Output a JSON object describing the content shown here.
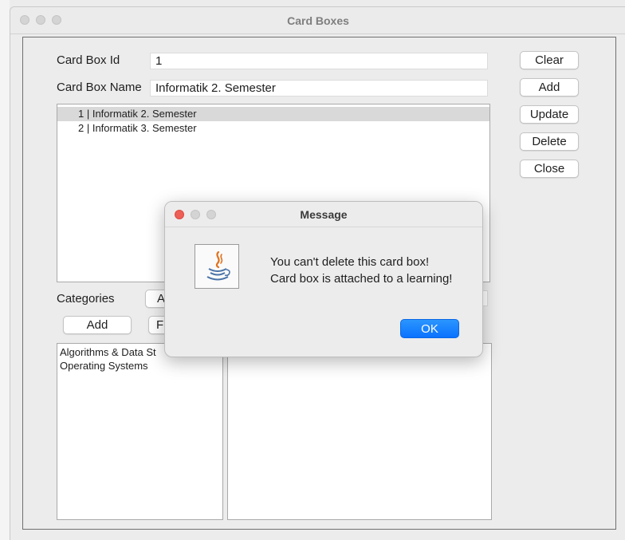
{
  "window": {
    "title": "Card Boxes"
  },
  "form": {
    "id_label": "Card Box Id",
    "id_value": "1",
    "name_label": "Card Box Name",
    "name_value": "Informatik 2. Semester"
  },
  "buttons": {
    "clear": "Clear",
    "add": "Add",
    "update": "Update",
    "delete": "Delete",
    "close": "Close"
  },
  "card_boxes": [
    "1 | Informatik 2. Semester",
    "2 | Informatik 3. Semester"
  ],
  "categories": {
    "label": "Categories",
    "combo_visible_text": "A",
    "add_label": "Add",
    "second_button_visible_text": "F",
    "items": [
      "Algorithms & Data St",
      "Operating Systems"
    ]
  },
  "dialog": {
    "title": "Message",
    "line1": "You can't delete this card box!",
    "line2": "Card box is attached to a learning!",
    "ok": "OK"
  },
  "colors": {
    "ok_button": "#0a72ff",
    "close_dot": "#ee5f57",
    "selection": "#d9d9d9"
  }
}
